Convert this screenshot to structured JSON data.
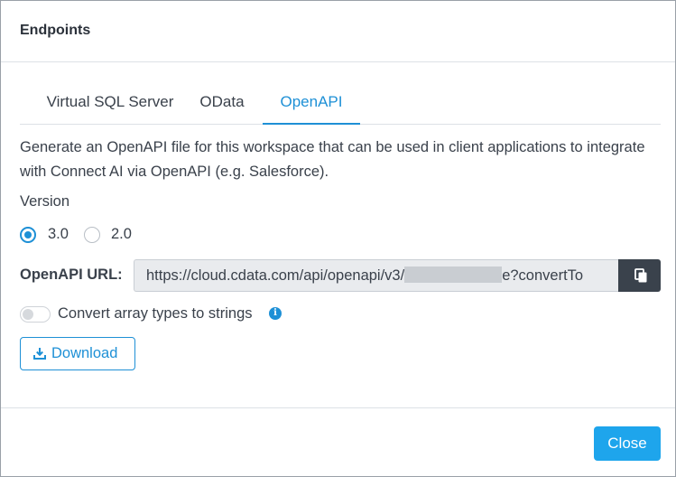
{
  "dialog": {
    "title": "Endpoints"
  },
  "tabs": [
    {
      "label": "Virtual SQL Server",
      "active": false
    },
    {
      "label": "OData",
      "active": false
    },
    {
      "label": "OpenAPI",
      "active": true
    }
  ],
  "openapi": {
    "description": "Generate an OpenAPI file for this workspace that can be used in client applications to integrate with Connect AI via OpenAPI (e.g. Salesforce).",
    "version_label": "Version",
    "versions": [
      {
        "label": "3.0",
        "selected": true
      },
      {
        "label": "2.0",
        "selected": false
      }
    ],
    "url_label": "OpenAPI URL:",
    "url_prefix": "https://cloud.cdata.com/api/openapi/v3/",
    "url_suffix": "e?convertTo",
    "copy_icon": "copy-icon",
    "toggle_label": "Convert array types to strings",
    "toggle_on": false,
    "info_icon": "info-icon",
    "download_label": "Download",
    "download_icon": "download-icon"
  },
  "footer": {
    "close_label": "Close"
  },
  "colors": {
    "accent": "#1e90d6",
    "close_button": "#1ea5ec",
    "copy_button": "#3a424c",
    "url_field_bg": "#e9ebee"
  }
}
